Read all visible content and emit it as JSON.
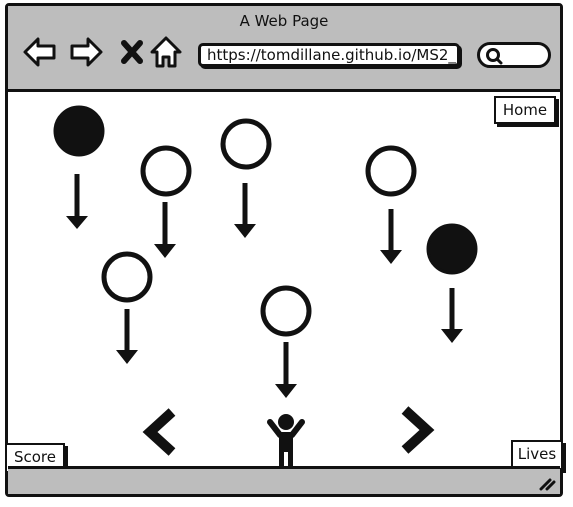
{
  "window": {
    "title": "A Web Page"
  },
  "browser": {
    "url": "https://tomdillane.github.io/MS2_",
    "nav_icons": [
      "back-arrow-icon",
      "forward-arrow-icon",
      "close-x-icon",
      "home-icon"
    ]
  },
  "game": {
    "home_label": "Home",
    "score_label": "Score",
    "lives_label": "Lives",
    "falling_objects": [
      {
        "fill": "filled"
      },
      {
        "fill": "hollow"
      },
      {
        "fill": "hollow"
      },
      {
        "fill": "hollow"
      },
      {
        "fill": "hollow"
      },
      {
        "fill": "filled"
      },
      {
        "fill": "hollow"
      }
    ],
    "controls": [
      "left-chevron-icon",
      "player-figure-icon",
      "right-chevron-icon"
    ]
  }
}
